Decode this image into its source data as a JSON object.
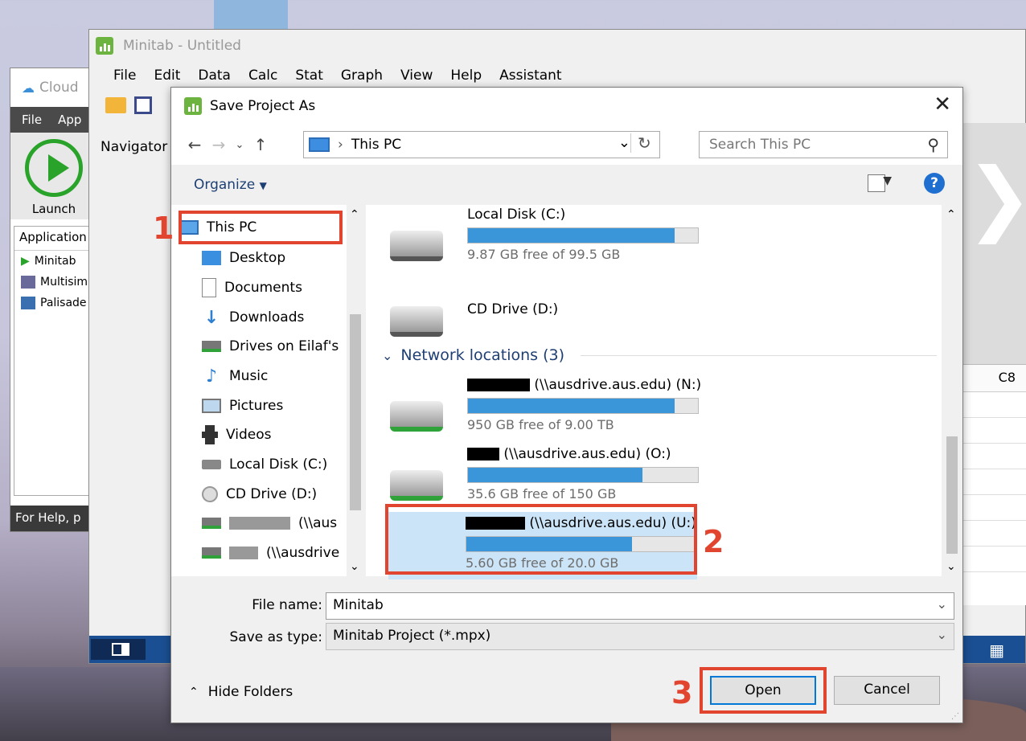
{
  "cloud_app": {
    "title": "Cloud",
    "menu": [
      "File",
      "App"
    ],
    "launch_label": "Launch",
    "tab_header": "Application",
    "apps": [
      "Minitab",
      "Multisim",
      "Palisade"
    ],
    "help_text": "For Help, p"
  },
  "minitab": {
    "title": "Minitab - Untitled",
    "menu": [
      "File",
      "Edit",
      "Data",
      "Calc",
      "Stat",
      "Graph",
      "View",
      "Help",
      "Assistant"
    ],
    "navigator_label": "Navigator",
    "column_header": "C8"
  },
  "dialog": {
    "title": "Save Project As",
    "address": "This PC",
    "search_placeholder": "Search This PC",
    "organize_label": "Organize",
    "tree": [
      {
        "label": "This PC",
        "icon": "pc-icon"
      },
      {
        "label": "Desktop",
        "icon": "desktop-icon"
      },
      {
        "label": "Documents",
        "icon": "documents-icon"
      },
      {
        "label": "Downloads",
        "icon": "downloads-icon"
      },
      {
        "label": "Drives on Eilaf's",
        "icon": "network-drive-icon"
      },
      {
        "label": "Music",
        "icon": "music-icon"
      },
      {
        "label": "Pictures",
        "icon": "pictures-icon"
      },
      {
        "label": "Videos",
        "icon": "videos-icon"
      },
      {
        "label": "Local Disk (C:)",
        "icon": "disk-icon"
      },
      {
        "label": "CD Drive (D:)",
        "icon": "cd-icon"
      },
      {
        "label": "(\\\\aus",
        "icon": "network-drive-icon"
      },
      {
        "label": "(\\\\ausdrive",
        "icon": "network-drive-icon"
      }
    ],
    "drives": [
      {
        "name": "Local Disk (C:)",
        "free": "9.87 GB free of 99.5 GB",
        "used_fraction": 0.9
      },
      {
        "name": "CD Drive (D:)"
      }
    ],
    "network_header": "Network locations (3)",
    "network_drives": [
      {
        "name": "(\\\\ausdrive.aus.edu) (N:)",
        "free": "950 GB free of 9.00 TB",
        "used_fraction": 0.9
      },
      {
        "name": "(\\\\ausdrive.aus.edu) (O:)",
        "free": "35.6 GB free of 150 GB",
        "used_fraction": 0.76
      },
      {
        "name": "(\\\\ausdrive.aus.edu) (U:)",
        "free": "5.60 GB free of 20.0 GB",
        "used_fraction": 0.72
      }
    ],
    "file_name_label": "File name:",
    "file_name_value": "Minitab",
    "save_type_label": "Save as type:",
    "save_type_value": "Minitab Project (*.mpx)",
    "hide_folders": "Hide Folders",
    "open_button": "Open",
    "cancel_button": "Cancel"
  },
  "annotations": {
    "step1": "1",
    "step2": "2",
    "step3": "3"
  },
  "colors": {
    "accent_red": "#e2452f",
    "minitab_green": "#6db33f",
    "bar_blue": "#3a96d8"
  }
}
